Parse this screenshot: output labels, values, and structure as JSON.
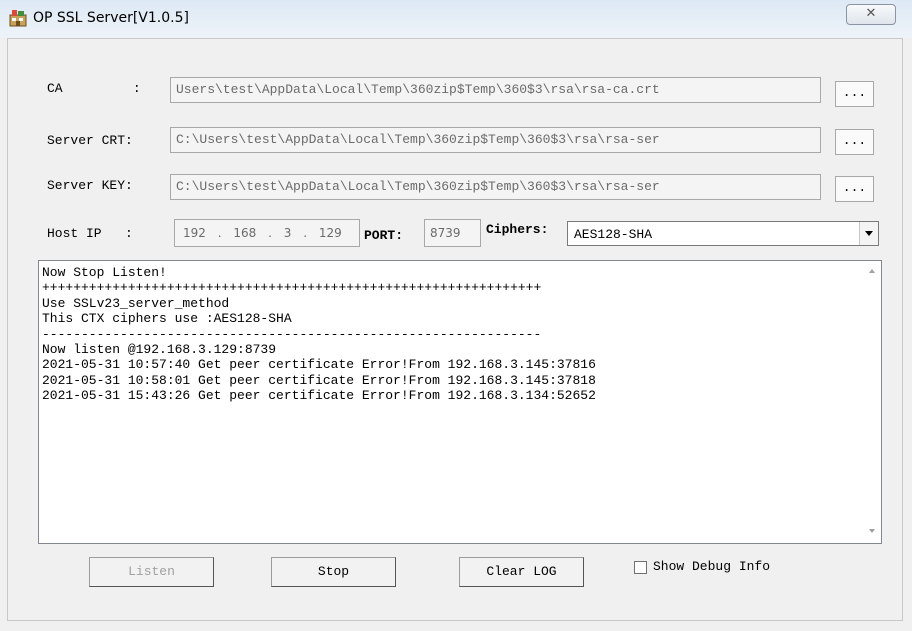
{
  "window": {
    "title": "OP SSL Server[V1.0.5]",
    "close_glyph": "✕"
  },
  "config": {
    "ca": {
      "label": "CA         :",
      "value": "Users\\test\\AppData\\Local\\Temp\\360zip$Temp\\360$3\\rsa\\rsa-ca.crt",
      "browse_label": "..."
    },
    "server_crt": {
      "label": "Server CRT:",
      "value": "C:\\Users\\test\\AppData\\Local\\Temp\\360zip$Temp\\360$3\\rsa\\rsa-ser",
      "browse_label": "..."
    },
    "server_key": {
      "label": "Server KEY:",
      "value": "C:\\Users\\test\\AppData\\Local\\Temp\\360zip$Temp\\360$3\\rsa\\rsa-ser",
      "browse_label": "..."
    },
    "host_ip": {
      "label": "Host IP   :",
      "octets": [
        "192",
        "168",
        "3",
        "129"
      ]
    },
    "port": {
      "label": "PORT:",
      "value": "8739"
    },
    "ciphers": {
      "label": "Ciphers:",
      "selected": "AES128-SHA"
    }
  },
  "log": {
    "lines": [
      "Now Stop Listen!",
      "++++++++++++++++++++++++++++++++++++++++++++++++++++++++++++++++",
      "Use SSLv23_server_method",
      "This CTX ciphers use :AES128-SHA",
      "----------------------------------------------------------------",
      "Now listen @192.168.3.129:8739",
      "2021-05-31 10:57:40 Get peer certificate Error!From 192.168.3.145:37816",
      "2021-05-31 10:58:01 Get peer certificate Error!From 192.168.3.145:37818",
      "2021-05-31 15:43:26 Get peer certificate Error!From 192.168.3.134:52652"
    ]
  },
  "buttons": {
    "listen": "Listen",
    "stop": "Stop",
    "clear_log": "Clear LOG"
  },
  "debug": {
    "label": "Show Debug Info",
    "checked": false
  }
}
